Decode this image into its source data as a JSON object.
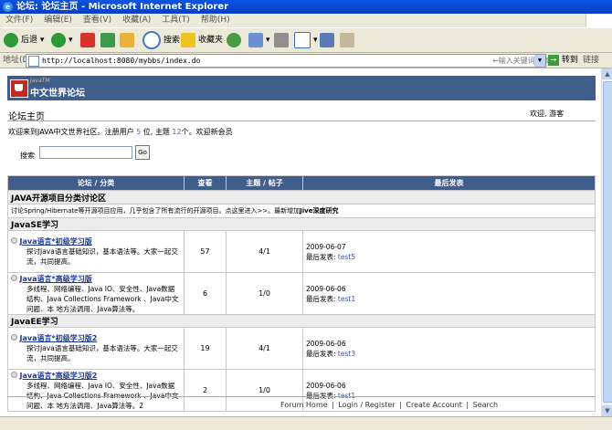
{
  "window": {
    "title": "论坛: 论坛主页 - Microsoft Internet Explorer"
  },
  "menu": [
    "文件(F)",
    "编辑(E)",
    "查看(V)",
    "收藏(A)",
    "工具(T)",
    "帮助(H)"
  ],
  "toolbar": {
    "back": "后退",
    "search": "搜索",
    "favorites": "收藏夹"
  },
  "address": {
    "label": "地址(D)",
    "url": "http://localhost:8080/mybbs/index.do",
    "keyword_placeholder": "←输入关键词搜索",
    "go": "转到",
    "links": "链接"
  },
  "page": {
    "brand_small": "JavaTM",
    "brand": "中文世界论坛",
    "home": "论坛主页",
    "welcome": "欢迎, 游客",
    "intro_a": "欢迎来到JAVA中文世界社区。注册用户 ",
    "users": "5",
    "intro_b": " 位, 主题 ",
    "topics": "12",
    "intro_c": "个。欢迎新会员",
    "search_label": "搜索",
    "go": "Go"
  },
  "table": {
    "headers": [
      "论坛 / 分类",
      "查看",
      "主题 / 帖子",
      "最后发表"
    ],
    "category": "JAVA开源项目分类讨论区",
    "category_desc": "讨论Spring/Hibernate等开源项目应用，几乎包含了所有流行的开源项目。点这里进入>>。最新增加",
    "category_desc_bold": "Jive深度研究",
    "sections": [
      {
        "name": "JavaSE学习",
        "forums": [
          {
            "title": "Java语言*初级学习版",
            "desc": "探讨Java语言基础知识，基本语法等。大家一起交流，共同提高。",
            "views": "57",
            "posts": "4/1",
            "date": "2009-06-07",
            "last_label": "最后发表: ",
            "user": "test5"
          },
          {
            "title": "Java语言*高级学习版",
            "desc": "多线程、网络编程、Java IO、安全性、Java数据结构、Java Collections Framework 、Java中文问题、本 地方法调用、Java算法等。",
            "views": "6",
            "posts": "1/0",
            "date": "2009-06-06",
            "last_label": "最后发表: ",
            "user": "test1"
          }
        ]
      },
      {
        "name": "JavaEE学习",
        "forums": [
          {
            "title": "Java语言*初级学习版2",
            "desc": "探讨Java语言基础知识，基本语法等。大家一起交流，共同提高。",
            "views": "19",
            "posts": "4/1",
            "date": "2009-06-06",
            "last_label": "最后发表: ",
            "user": "test3"
          },
          {
            "title": "Java语言*高级学习版2",
            "desc": "多线程、网络编程、Java IO、安全性、Java数据结构、Java Collections Framework 、Java中文问题、本 地方法调用、Java算法等。2",
            "views": "2",
            "posts": "1/0",
            "date": "2009-06-06",
            "last_label": "最后发表: ",
            "user": "test1"
          }
        ]
      }
    ]
  },
  "footer": [
    "Forum Home",
    "Login / Register",
    "Create Account",
    "Search"
  ],
  "colors": {
    "header_bg": "#3f5e8c",
    "link": "#1a3a9a"
  }
}
